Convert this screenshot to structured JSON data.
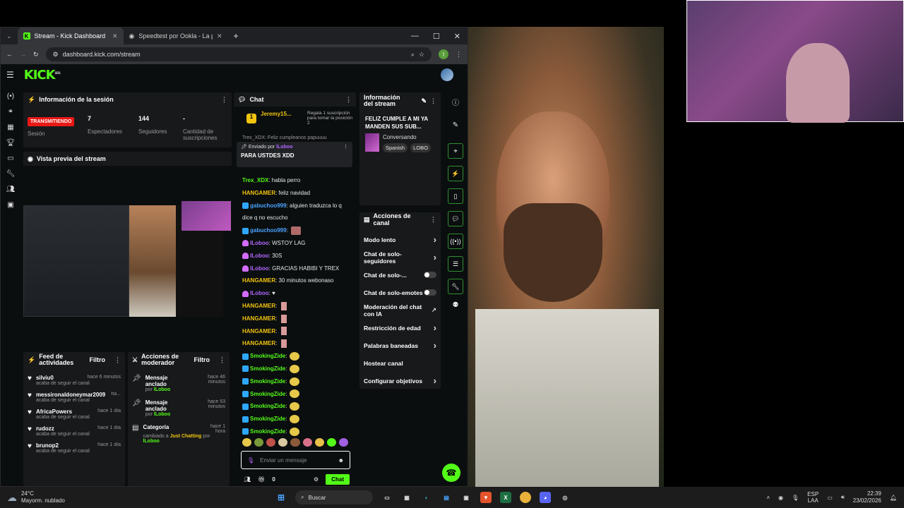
{
  "browser": {
    "tabs": [
      {
        "label": "Stream - Kick Dashboard",
        "active": true
      },
      {
        "label": "Speedtest por Ookla - La prueb",
        "active": false
      }
    ],
    "url": "dashboard.kick.com/stream",
    "profile_initial": "l"
  },
  "kick": {
    "logo": "KICK",
    "logo_sup": "BETA"
  },
  "session": {
    "title": "Información de la sesión",
    "live_badge": "TRANSMITIENDO",
    "live_label": "Sesión",
    "viewers_value": "7",
    "viewers_label": "Espectadores",
    "followers_value": "144",
    "followers_label": "Seguidores",
    "subs_value": "-",
    "subs_label": "Cantidad de suscripciones"
  },
  "preview": {
    "title": "Vista previa del stream"
  },
  "chat": {
    "title": "Chat",
    "gift_user": "Jeremy15...",
    "gift_count": "1",
    "gift_text": "Regala 1 suscripción para tomar la posición 2",
    "partial_line": "Trex_XDX: Feliz cumpleanos papuuuu",
    "pinned_by_label": "Enviado por",
    "pinned_by_user": "lLoboo",
    "pinned_msg": "PARA USTDES XDD",
    "messages": [
      {
        "user": "Trex_XDX",
        "text": ": habla perro",
        "color": "green"
      },
      {
        "user": "HANGAMER",
        "text": ": feliz navidad",
        "color": "yellow"
      },
      {
        "user": "gabuchoo999",
        "text": ": alguien traduzca lo q",
        "color": "blue"
      },
      {
        "user": "",
        "text": "dice q no escucho",
        "color": ""
      },
      {
        "user": "gabuchoo999",
        "text": ":",
        "color": "blue"
      },
      {
        "user": "lLoboo",
        "text": ": WSTOY LAG",
        "color": "purple"
      },
      {
        "user": "lLoboo",
        "text": ": 30S",
        "color": "purple"
      },
      {
        "user": "lLoboo",
        "text": ": GRACIAS HABIBI Y TREX",
        "color": "purple"
      },
      {
        "user": "HANGAMER",
        "text": ": 30 minutos webonaso",
        "color": "yellow"
      },
      {
        "user": "lLoboo",
        "text": ": ♥",
        "color": "purple"
      },
      {
        "user": "HANGAMER",
        "text": ":",
        "color": "yellow"
      },
      {
        "user": "HANGAMER",
        "text": ":",
        "color": "yellow"
      },
      {
        "user": "HANGAMER",
        "text": ":",
        "color": "yellow"
      },
      {
        "user": "HANGAMER",
        "text": ":",
        "color": "yellow"
      },
      {
        "user": "SmokingZide",
        "text": ":",
        "color": "green"
      },
      {
        "user": "SmokingZide",
        "text": ":",
        "color": "green"
      },
      {
        "user": "SmokingZide",
        "text": ":",
        "color": "green"
      },
      {
        "user": "SmokingZide",
        "text": ":",
        "color": "green"
      },
      {
        "user": "SmokingZide",
        "text": ":",
        "color": "green"
      },
      {
        "user": "SmokingZide",
        "text": ":",
        "color": "green"
      },
      {
        "user": "SmokingZide",
        "text": ":",
        "color": "green"
      }
    ],
    "input_placeholder": "Enviar un mensaje",
    "points": "0",
    "send_label": "Chat"
  },
  "stream_info": {
    "title": "Información del stream",
    "stream_title": "FELIZ CUMPLE A MI YA MANDEN SUS SUB...",
    "category": "Conversando",
    "tags": [
      "Spanish",
      "LOBO"
    ]
  },
  "channel_actions": {
    "title": "Acciones de canal",
    "items": [
      {
        "label": "Modo lento",
        "control": "chevron"
      },
      {
        "label": "Chat de solo-seguidores",
        "control": "chevron"
      },
      {
        "label": "Chat de solo-...",
        "control": "toggle"
      },
      {
        "label": "Chat de solo-emotes",
        "control": "toggle"
      },
      {
        "label": "Moderación del chat con IA",
        "control": "external"
      },
      {
        "label": "Restricción de edad",
        "control": "chevron"
      },
      {
        "label": "Palabras baneadas",
        "control": "chevron"
      },
      {
        "label": "Hostear canal",
        "control": "none"
      },
      {
        "label": "Configurar objetivos",
        "control": "chevron"
      }
    ]
  },
  "activity": {
    "title": "Feed de actividades",
    "filter": "Filtro",
    "items": [
      {
        "user": "silviu0",
        "time": "hace 6 minutos",
        "action": "acaba de seguir el canal"
      },
      {
        "user": "messironaldoneymar2009",
        "time": "ha...",
        "action": "acaba de seguir el canal"
      },
      {
        "user": "AfricaPowers",
        "time": "hace 1 día",
        "action": "acaba de seguir el canal"
      },
      {
        "user": "rudozz",
        "time": "hace 1 día",
        "action": "acaba de seguir el canal"
      },
      {
        "user": "brunop2",
        "time": "hace 1 día",
        "action": "acaba de seguir el canal"
      }
    ]
  },
  "mod_actions": {
    "title": "Acciones de moderador",
    "filter": "Filtro",
    "items": [
      {
        "title": "Mensaje anclado",
        "time": "hace 46 minutos",
        "by": "por",
        "user": "lLoboo"
      },
      {
        "title": "Mensaje anclado",
        "time": "hace 53 minutos",
        "by": "por",
        "user": "lLoboo"
      },
      {
        "title": "Categoría",
        "time": "hace 1 hora",
        "detail": "cambiado a",
        "cat": "Just Chatting",
        "by": "por",
        "user": "lLoboo"
      }
    ]
  },
  "taskbar": {
    "weather_temp": "24°C",
    "weather_desc": "Mayorm. nublado",
    "search": "Buscar",
    "lang_1": "ESP",
    "lang_2": "LAA",
    "time": "22:39",
    "date": "23/02/2026"
  }
}
